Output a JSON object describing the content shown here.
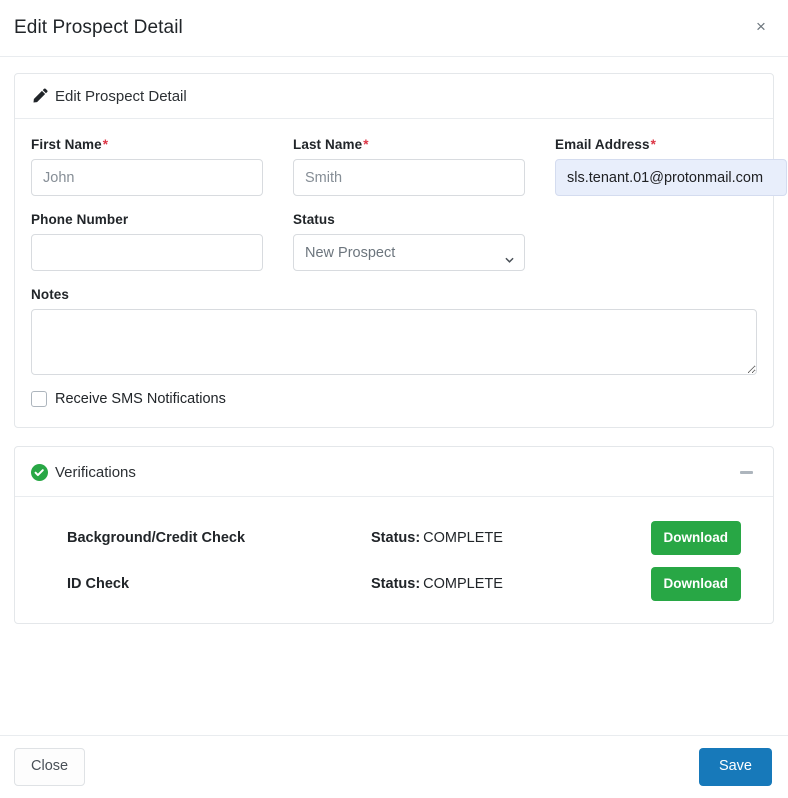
{
  "modal": {
    "title": "Edit Prospect Detail",
    "close_icon": "close-icon",
    "close_label": "×"
  },
  "detail_card": {
    "icon": "pencil-icon",
    "header": "Edit Prospect Detail",
    "fields": {
      "first_name": {
        "label": "First Name",
        "required_mark": "*",
        "value": "",
        "placeholder": "John"
      },
      "last_name": {
        "label": "Last Name",
        "required_mark": "*",
        "value": "",
        "placeholder": "Smith"
      },
      "email": {
        "label": "Email Address",
        "required_mark": "*",
        "value": "sls.tenant.01@protonmail.com",
        "placeholder": ""
      },
      "phone": {
        "label": "Phone Number",
        "value": "",
        "placeholder": ""
      },
      "status": {
        "label": "Status",
        "selected": "New Prospect",
        "options": [
          "New Prospect"
        ],
        "chevron_icon": "chevron-down-icon"
      },
      "notes": {
        "label": "Notes",
        "value": "",
        "placeholder": ""
      },
      "sms": {
        "label": "Receive SMS Notifications",
        "checked": false
      }
    }
  },
  "verifications_card": {
    "icon": "check-circle-icon",
    "header": "Verifications",
    "collapse_icon": "minus-icon",
    "accent_green": "#28a745",
    "rows": [
      {
        "name": "Background/Credit Check",
        "status_key": "Status:",
        "status_value": "COMPLETE",
        "action_label": "Download"
      },
      {
        "name": "ID Check",
        "status_key": "Status:",
        "status_value": "COMPLETE",
        "action_label": "Download"
      }
    ]
  },
  "footer": {
    "close_label": "Close",
    "save_label": "Save",
    "save_color": "#1779ba"
  }
}
